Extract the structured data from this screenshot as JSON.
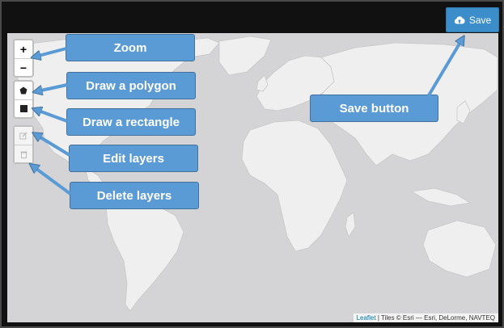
{
  "toolbar": {
    "save_label": "Save",
    "save_icon": "cloud-upload-icon"
  },
  "map": {
    "zoom_in_label": "+",
    "zoom_out_label": "−",
    "draw_tools": [
      "pentagon-icon",
      "square-icon"
    ],
    "edit_tools": [
      "edit-icon",
      "trash-icon"
    ],
    "attribution_link": "Leaflet",
    "attribution_text": " | Tiles © Esri — Esri, DeLorme, NAVTEQ"
  },
  "annotations": {
    "zoom": "Zoom",
    "polygon": "Draw a polygon",
    "rectangle": "Draw a rectangle",
    "edit": "Edit layers",
    "delete": "Delete layers",
    "save": "Save button"
  },
  "colors": {
    "callout_fill": "#5b9bd5",
    "callout_border": "#41719c",
    "save_button": "#3b8ec9",
    "map_water": "#d4d4d6",
    "map_land": "#efefef"
  }
}
